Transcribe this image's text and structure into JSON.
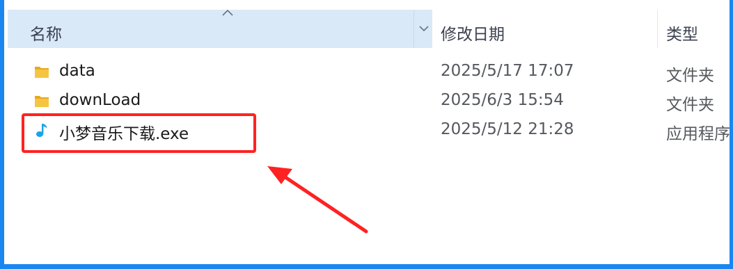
{
  "columns": {
    "name": "名称",
    "date_modified": "修改日期",
    "type": "类型"
  },
  "files": [
    {
      "icon": "folder-icon",
      "name": "data",
      "date": "2025/5/17 17:07",
      "type": "文件夹"
    },
    {
      "icon": "folder-icon",
      "name": "downLoad",
      "date": "2025/6/3 15:54",
      "type": "文件夹"
    },
    {
      "icon": "music-note-icon",
      "name": "小梦音乐下载.exe",
      "date": "2025/5/12 21:28",
      "type": "应用程序"
    }
  ],
  "colors": {
    "frame_border": "#1a86f0",
    "header_selected_bg": "#d9e9f8",
    "highlight_box": "#ff2222",
    "annotation_arrow": "#ff2222",
    "folder_yellow": "#f5c542",
    "music_icon_blue": "#1aa3e8"
  }
}
